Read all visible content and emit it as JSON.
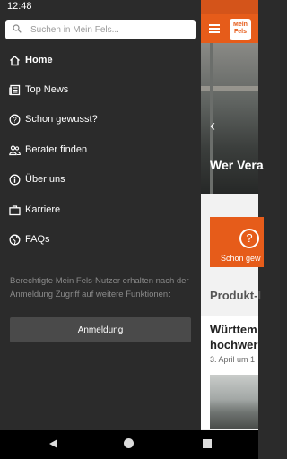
{
  "status_bar": {
    "time": "12:48"
  },
  "search": {
    "placeholder": "Suchen in Mein Fels..."
  },
  "menu": {
    "items": [
      {
        "label": "Home",
        "icon": "home-icon"
      },
      {
        "label": "Top News",
        "icon": "news-icon"
      },
      {
        "label": "Schon gewusst?",
        "icon": "question-circle-icon"
      },
      {
        "label": "Berater finden",
        "icon": "people-icon"
      },
      {
        "label": "Über uns",
        "icon": "info-circle-icon"
      },
      {
        "label": "Karriere",
        "icon": "briefcase-icon"
      },
      {
        "label": "FAQs",
        "icon": "globe-icon"
      }
    ],
    "active_index": 0
  },
  "info": {
    "text": "Berechtigte Mein Fels-Nutzer erhalten nach der Anmeldung Zugriff auf weitere Funktionen:"
  },
  "login_button": {
    "label": "Anmeldung"
  },
  "app": {
    "logo_line1": "Mein",
    "logo_line2": "Fels",
    "hero_text": "Wer Vera",
    "card_label": "Schon gew",
    "section_title": "Produkt-I",
    "news_title_line1": "Württem",
    "news_title_line2": "hochwer",
    "news_date": "3. April um 1"
  },
  "colors": {
    "accent": "#e65c1a",
    "drawer_bg": "#2b2b2b",
    "button_bg": "#4a4a4a"
  }
}
